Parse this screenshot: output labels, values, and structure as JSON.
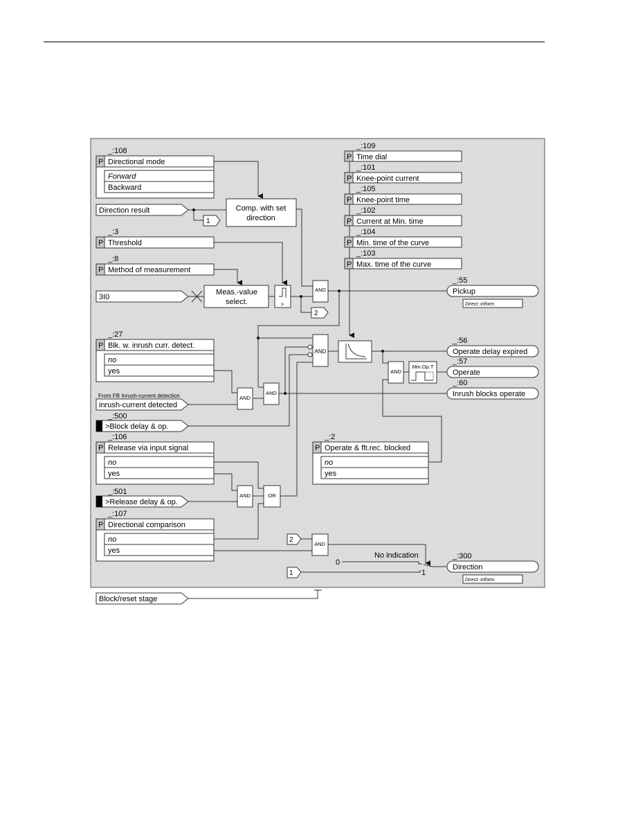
{
  "colors": {
    "panel": "#dcdcdc",
    "panel_border": "#555555",
    "param_tag": "#c8c8c8",
    "wire": "#333333"
  },
  "params": [
    {
      "id": "_:108",
      "tag": "P",
      "name": "Directional mode",
      "options": [
        {
          "label": "Forward",
          "italic": true
        },
        {
          "label": "Backward",
          "italic": false
        }
      ]
    },
    {
      "id": "_:3",
      "tag": "P",
      "name": "Threshold",
      "options": []
    },
    {
      "id": "_:8",
      "tag": "P",
      "name": "Method of measurement",
      "options": []
    },
    {
      "id": "_:27",
      "tag": "P",
      "name": "Blk. w. inrush curr. detect.",
      "options": [
        {
          "label": "no",
          "italic": true
        },
        {
          "label": "yes",
          "italic": false
        }
      ]
    },
    {
      "id": "_:106",
      "tag": "P",
      "name": "Release via input signal",
      "options": [
        {
          "label": "no",
          "italic": true
        },
        {
          "label": "yes",
          "italic": false
        }
      ]
    },
    {
      "id": "_:107",
      "tag": "P",
      "name": "Directional comparison",
      "options": [
        {
          "label": "no",
          "italic": true
        },
        {
          "label": "yes",
          "italic": false
        }
      ]
    },
    {
      "id": "_:2",
      "tag": "P",
      "name": "Operate & flt.rec. blocked",
      "options": [
        {
          "label": "no",
          "italic": true
        },
        {
          "label": "yes",
          "italic": false
        }
      ]
    }
  ],
  "curve_params": [
    {
      "id": "_:109",
      "tag": "P",
      "name": "Time dial"
    },
    {
      "id": "_:101",
      "tag": "P",
      "name": "Knee-point current"
    },
    {
      "id": "_:105",
      "tag": "P",
      "name": "Knee-point time"
    },
    {
      "id": "_:102",
      "tag": "P",
      "name": "Current at Min. time"
    },
    {
      "id": "_:104",
      "tag": "P",
      "name": "Min. time of the curve"
    },
    {
      "id": "_:103",
      "tag": "P",
      "name": "Max. time of the curve"
    }
  ],
  "inputs": {
    "direction_result": "Direction result",
    "i3i0": "3I0",
    "inrush_caption": "From FB Inrush-current detection",
    "inrush": "inrush-current detected",
    "block_delay_id": "_:500",
    "block_delay": ">Block delay & op.",
    "release_delay_id": "_:501",
    "release_delay": ">Release delay & op.",
    "block_reset": "Block/reset stage"
  },
  "blocks": {
    "comp_line1": "Comp. with set",
    "comp_line2": "direction",
    "meas_line1": "Meas.-value",
    "meas_line2": "select.",
    "and": "AND",
    "or": "OR",
    "min_op_t": "Min.Op.T",
    "threshold_sym": ">"
  },
  "connectors": {
    "c1": "1",
    "c2": "2"
  },
  "outputs": [
    {
      "id": "_:55",
      "name": "Pickup",
      "info": "Direct.-inform."
    },
    {
      "id": "_:56",
      "name": "Operate delay expired"
    },
    {
      "id": "_:57",
      "name": "Operate"
    },
    {
      "id": "_:60",
      "name": "Inrush blocks operate"
    },
    {
      "id": "_:300",
      "name": "Direction",
      "info": "Direct.-inform."
    }
  ],
  "switch": {
    "label": "No indication",
    "pos0": "0",
    "pos1": "1"
  }
}
